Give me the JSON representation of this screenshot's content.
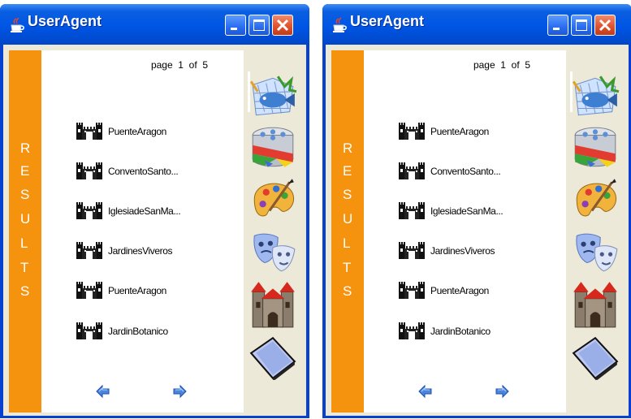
{
  "windows": [
    {
      "title": "UserAgent",
      "results_label": [
        "R",
        "E",
        "S",
        "U",
        "L",
        "T",
        "S"
      ],
      "page_indicator": "page  1  of  5",
      "items": [
        {
          "label": "PuenteAragon"
        },
        {
          "label": "ConventoSanto..."
        },
        {
          "label": "IglesiadeSanMa..."
        },
        {
          "label": "JardinesViveros"
        },
        {
          "label": "PuenteAragon"
        },
        {
          "label": "JardinBotanico"
        }
      ],
      "categories": [
        "fish-net-icon",
        "film-reel-icon",
        "paint-palette-icon",
        "theater-masks-icon",
        "castle-icon",
        "book-icon"
      ],
      "buttons": [
        "minimize-icon",
        "maximize-icon",
        "close-icon"
      ]
    },
    {
      "title": "UserAgent",
      "results_label": [
        "R",
        "E",
        "S",
        "U",
        "L",
        "T",
        "S"
      ],
      "page_indicator": "page  1  of  5",
      "items": [
        {
          "label": "PuenteAragon"
        },
        {
          "label": "ConventoSanto..."
        },
        {
          "label": "IglesiadeSanMa..."
        },
        {
          "label": "JardinesViveros"
        },
        {
          "label": "PuenteAragon"
        },
        {
          "label": "JardinBotanico"
        }
      ],
      "categories": [
        "fish-net-icon",
        "film-reel-icon",
        "paint-palette-icon",
        "theater-masks-icon",
        "castle-icon",
        "book-icon"
      ],
      "buttons": [
        "minimize-icon",
        "maximize-icon",
        "close-icon"
      ]
    }
  ],
  "colors": {
    "results_band": "#f5930f",
    "titlebar": "#0055e5",
    "close_button": "#e0542e",
    "client": "#ece9d8"
  }
}
